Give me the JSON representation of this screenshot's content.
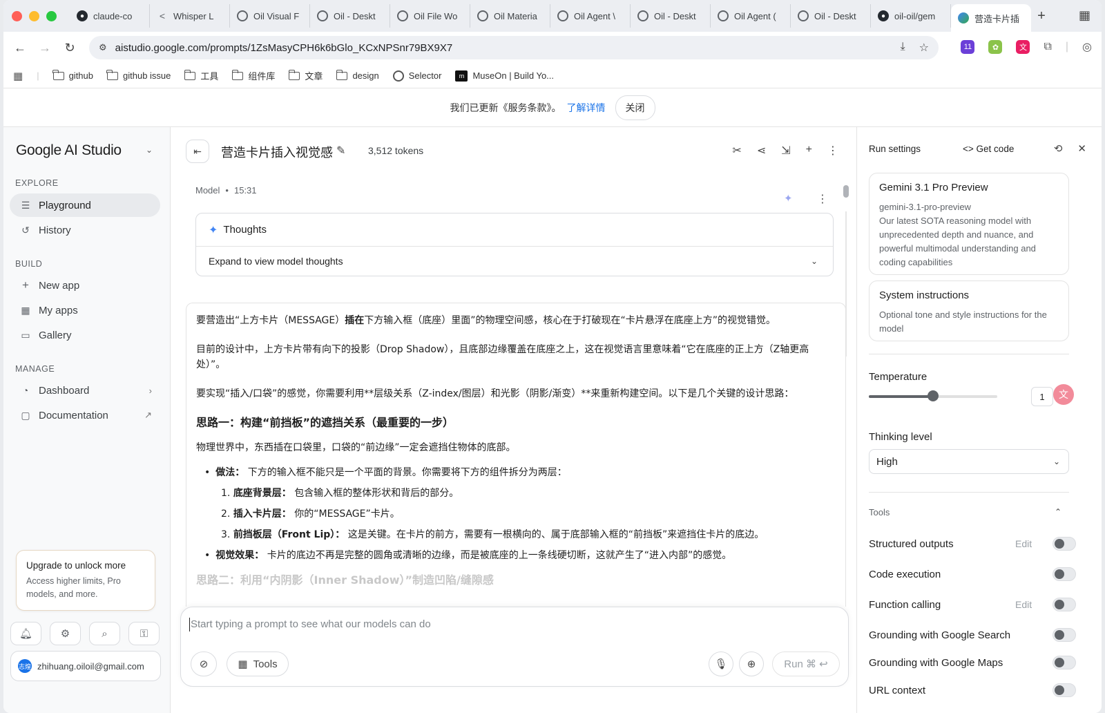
{
  "browser": {
    "tabs": [
      {
        "label": "claude-co",
        "icon": "github-icon"
      },
      {
        "label": "Whisper L",
        "icon": "share-icon"
      },
      {
        "label": "Oil Visual F",
        "icon": "globe-icon"
      },
      {
        "label": "Oil - Deskt",
        "icon": "globe-icon"
      },
      {
        "label": "Oil File Wo",
        "icon": "globe-icon"
      },
      {
        "label": "Oil Materia",
        "icon": "globe-icon"
      },
      {
        "label": "Oil Agent \\",
        "icon": "globe-icon"
      },
      {
        "label": "Oil - Deskt",
        "icon": "globe-icon"
      },
      {
        "label": "Oil Agent (",
        "icon": "globe-icon"
      },
      {
        "label": "Oil - Deskt",
        "icon": "globe-icon"
      },
      {
        "label": "oil-oil/gem",
        "icon": "github-icon"
      },
      {
        "label": "营造卡片插",
        "icon": "ai-studio-icon"
      }
    ],
    "url": "aistudio.google.com/prompts/1ZsMasyCPH6k6bGlo_KCxNPSnr79BX9X7",
    "extension_badge": "11",
    "bookmarks": [
      {
        "label": "github",
        "icon": "folder-icon"
      },
      {
        "label": "github issue",
        "icon": "folder-icon"
      },
      {
        "label": "工具",
        "icon": "folder-icon"
      },
      {
        "label": "组件库",
        "icon": "folder-icon"
      },
      {
        "label": "文章",
        "icon": "folder-icon"
      },
      {
        "label": "design",
        "icon": "folder-icon"
      },
      {
        "label": "Selector",
        "icon": "globe-icon"
      },
      {
        "label": "MuseOn | Build Yo...",
        "icon": "museon-icon"
      }
    ]
  },
  "notice": {
    "text": "我们已更新《服务条款》。",
    "link": "了解详情",
    "close": "关闭"
  },
  "sidebar": {
    "brand": "Google AI Studio",
    "explore_label": "EXPLORE",
    "explore": [
      {
        "label": "Playground",
        "icon": "playground-icon"
      },
      {
        "label": "History",
        "icon": "history-icon"
      }
    ],
    "build_label": "BUILD",
    "build": [
      {
        "label": "New app",
        "icon": "plus-icon"
      },
      {
        "label": "My apps",
        "icon": "apps-icon"
      },
      {
        "label": "Gallery",
        "icon": "gallery-icon"
      }
    ],
    "manage_label": "MANAGE",
    "manage": [
      {
        "label": "Dashboard",
        "icon": "dashboard-icon"
      },
      {
        "label": "Documentation",
        "icon": "documentation-icon"
      }
    ],
    "upgrade_title": "Upgrade to unlock more",
    "upgrade_desc": "Access higher limits, Pro models, and more.",
    "account": "zhihuang.oiloil@gmail.com",
    "avatar_text": "志煌"
  },
  "main": {
    "title": "营造卡片插入视觉感",
    "tokens": "3,512 tokens",
    "role": "Model",
    "time": "15:31",
    "thoughts_label": "Thoughts",
    "thoughts_expand": "Expand to view model thoughts",
    "answer": {
      "p1": "要营造出“上方卡片（MESSAGE）插在下方输入框（底座）里面”的物理空间感，核心在于打破现在“卡片悬浮在底座上方”的视觉错觉。",
      "p1_bold": "插在",
      "p2": "目前的设计中，上方卡片带有向下的投影（Drop Shadow），且底部边缘覆盖在底座之上，这在视觉语言里意味着“它在底座的正上方（Z轴更高处）”。",
      "p3": "要实现“插入/口袋”的感觉，你需要利用**层级关系（Z-index/图层）和光影（阴影/渐变）**来重新构建空间。以下是几个关键的设计思路：",
      "h1": "思路一：构建“前挡板”的遮挡关系（最重要的一步）",
      "p4": "物理世界中，东西插在口袋里，口袋的“前边缘”一定会遮挡住物体的底部。",
      "b1_label": "做法：",
      "b1_text": "下方的输入框不能只是一个平面的背景。你需要将下方的组件拆分为两层：",
      "ol": [
        {
          "n": "1.",
          "label": "底座背景层：",
          "text": "包含输入框的整体形状和背后的部分。"
        },
        {
          "n": "2.",
          "label": "插入卡片层：",
          "text": "你的“MESSAGE”卡片。"
        },
        {
          "n": "3.",
          "label": "前挡板层（Front Lip）：",
          "text": "这是关键。在卡片的前方，需要有一根横向的、属于底部输入框的“前挡板”来遮挡住卡片的底边。"
        }
      ],
      "b2_label": "视觉效果：",
      "b2_text": "卡片的底边不再是完整的圆角或清晰的边缘，而是被底座的上一条线硬切断，这就产生了“进入内部”的感觉。",
      "h2_faded": "思路二：利用“内阴影（Inner Shadow）”制造凹陷/缝隙感"
    },
    "composer_placeholder": "Start typing a prompt to see what our models can do",
    "tools_label": "Tools",
    "run_label": "Run ⌘ ↩"
  },
  "run_settings": {
    "title": "Run settings",
    "get_code": "Get code",
    "model_name": "Gemini 3.1 Pro Preview",
    "model_id": "gemini-3.1-pro-preview",
    "model_desc": "Our latest SOTA reasoning model with unprecedented depth and nuance, and powerful multimodal understanding and coding capabilities",
    "sys_title": "System instructions",
    "sys_desc": "Optional tone and style instructions for the model",
    "temperature_label": "Temperature",
    "temperature_value": "1",
    "temperature_level": 0.5,
    "thinking_label": "Thinking level",
    "thinking_value": "High",
    "tools_label": "Tools",
    "tools": [
      {
        "label": "Structured outputs",
        "edit": "Edit"
      },
      {
        "label": "Code execution",
        "edit": ""
      },
      {
        "label": "Function calling",
        "edit": "Edit"
      },
      {
        "label": "Grounding with Google Search",
        "edit": ""
      },
      {
        "label": "Grounding with Google Maps",
        "edit": ""
      },
      {
        "label": "URL context",
        "edit": ""
      }
    ]
  }
}
